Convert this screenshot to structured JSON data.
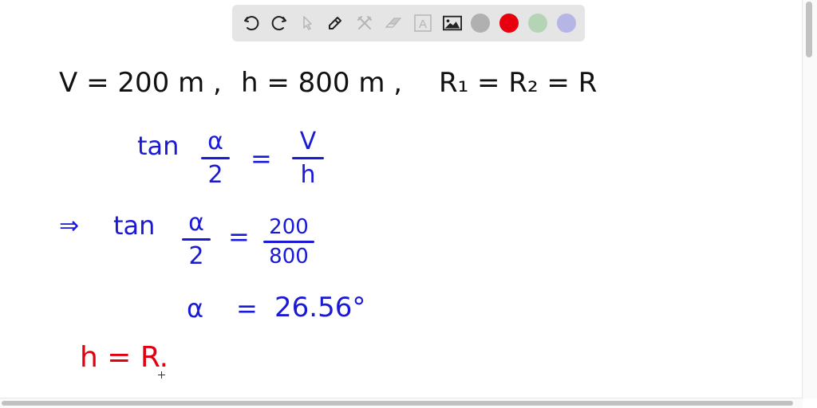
{
  "toolbar": {
    "tools": [
      {
        "name": "undo-icon",
        "label": "Undo",
        "enabled": true
      },
      {
        "name": "redo-icon",
        "label": "Redo",
        "enabled": true
      },
      {
        "name": "select-pointer-icon",
        "label": "Select",
        "enabled": false
      },
      {
        "name": "pen-icon",
        "label": "Pen",
        "enabled": true
      },
      {
        "name": "tools-icon",
        "label": "Tools",
        "enabled": false
      },
      {
        "name": "eraser-icon",
        "label": "Eraser",
        "enabled": false
      },
      {
        "name": "text-icon",
        "label": "A",
        "enabled": false
      },
      {
        "name": "image-icon",
        "label": "Image",
        "enabled": true
      }
    ],
    "colors": [
      "#b0b0b0",
      "#e8000e",
      "#b5d4b5",
      "#b5b5e6"
    ],
    "selected_color": "#e8000e"
  },
  "canvas": {
    "line1": {
      "v": "V = 200 m ,",
      "h": "h = 800 m ,",
      "r": "R₁ = R₂ = R"
    },
    "eq1": {
      "lhs": "tan",
      "lhs_num": "α",
      "lhs_den": "2",
      "eq": "=",
      "rhs_num": "V",
      "rhs_den": "h"
    },
    "eq2": {
      "arrow": "⇒",
      "lhs": "tan",
      "lhs_num": "α",
      "lhs_den": "2",
      "eq": "=",
      "rhs_num": "200",
      "rhs_den": "800"
    },
    "eq3": {
      "lhs": "α",
      "eq": "=",
      "value": "26.56°"
    },
    "eq4": {
      "text": "h = R."
    }
  },
  "colors": {
    "black_ink": "#111111",
    "blue_ink": "#1a1ad6",
    "red_ink": "#e00010"
  },
  "scroll": {
    "vertical_position": 0,
    "horizontal_visible_fraction": 0.98
  }
}
